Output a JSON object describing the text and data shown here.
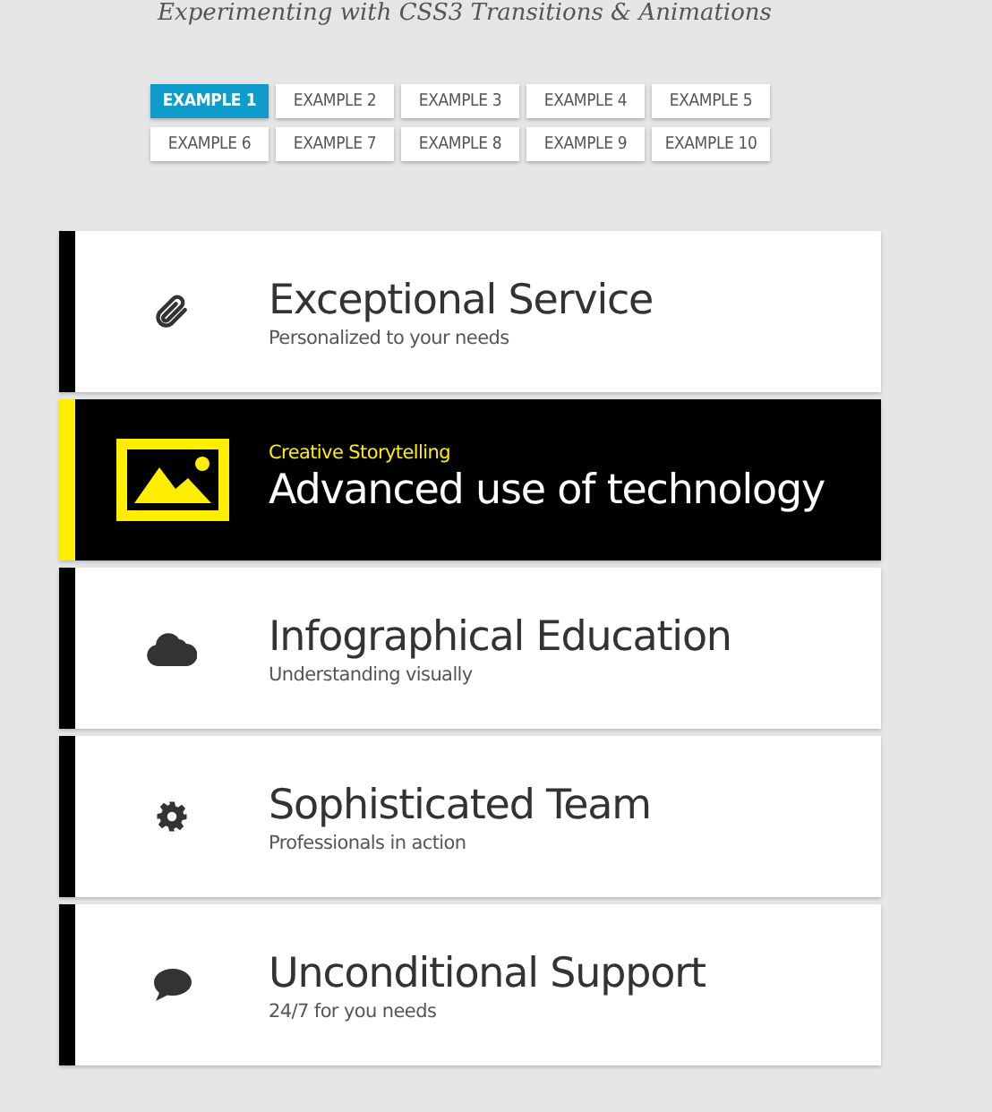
{
  "header": {
    "subtitle": "Experimenting with CSS3 Transitions & Animations"
  },
  "tabs": [
    {
      "label": "EXAMPLE 1",
      "selected": true
    },
    {
      "label": "EXAMPLE 2",
      "selected": false
    },
    {
      "label": "EXAMPLE 3",
      "selected": false
    },
    {
      "label": "EXAMPLE 4",
      "selected": false
    },
    {
      "label": "EXAMPLE 5",
      "selected": false
    },
    {
      "label": "EXAMPLE 6",
      "selected": false
    },
    {
      "label": "EXAMPLE 7",
      "selected": false
    },
    {
      "label": "EXAMPLE 8",
      "selected": false
    },
    {
      "label": "EXAMPLE 9",
      "selected": false
    },
    {
      "label": "EXAMPLE 10",
      "selected": false
    }
  ],
  "items": [
    {
      "title": "Exceptional Service",
      "subtitle": "Personalized to your needs",
      "selected": false
    },
    {
      "title": "Advanced use of technology",
      "subtitle": "Creative Storytelling",
      "selected": true
    },
    {
      "title": "Infographical Education",
      "subtitle": "Understanding visually",
      "selected": false
    },
    {
      "title": "Sophisticated Team",
      "subtitle": "Professionals in action",
      "selected": false
    },
    {
      "title": "Unconditional Support",
      "subtitle": "24/7 for you needs",
      "selected": false
    }
  ]
}
